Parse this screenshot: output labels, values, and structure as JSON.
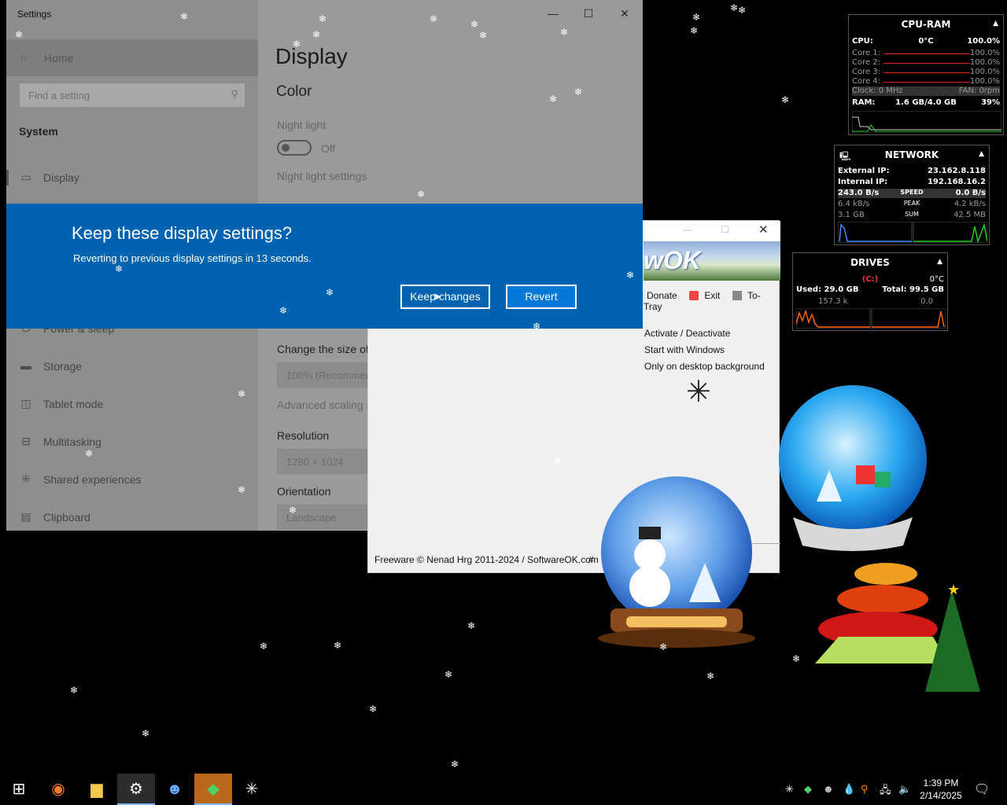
{
  "settings": {
    "window_title": "Settings",
    "controls": {
      "minimize": "—",
      "maximize": "☐",
      "close": "✕"
    },
    "sidebar": {
      "home": "Home",
      "search_placeholder": "Find a setting",
      "section": "System",
      "items": [
        {
          "label": "Display",
          "icon": "monitor-icon"
        },
        {
          "label": "Power & sleep",
          "icon": "power-icon"
        },
        {
          "label": "Storage",
          "icon": "storage-icon"
        },
        {
          "label": "Tablet mode",
          "icon": "tablet-icon"
        },
        {
          "label": "Multitasking",
          "icon": "multitasking-icon"
        },
        {
          "label": "Shared experiences",
          "icon": "shared-icon"
        },
        {
          "label": "Clipboard",
          "icon": "clipboard-icon"
        }
      ]
    },
    "content": {
      "title": "Display",
      "section_color": "Color",
      "night_light_label": "Night light",
      "night_light_state": "Off",
      "night_light_settings": "Night light settings",
      "scale_label": "Change the size of text, apps, and other items",
      "scale_value": "100% (Recommended)",
      "advanced_scaling": "Advanced scaling settings",
      "resolution_label": "Resolution",
      "resolution_value": "1280 × 1024",
      "orientation_label": "Orientation",
      "orientation_value": "Landscape"
    }
  },
  "dialog": {
    "title": "Keep these display settings?",
    "message": "Reverting to previous display settings in 13 seconds.",
    "keep_button": "Keep changes",
    "revert_button": "Revert"
  },
  "softwareok": {
    "banner_text": "wOK",
    "menu": {
      "donate": "Donate",
      "exit": "Exit",
      "to_tray": "To-Tray"
    },
    "options": [
      "Activate / Deactivate",
      "Start with Windows",
      "Only on desktop background"
    ],
    "footer": "Freeware © Nenad Hrg 2011-2024 / SoftwareOK.com",
    "footer_hash": "#"
  },
  "cpu_gadget": {
    "title": "CPU-RAM",
    "cpu_label": "CPU:",
    "cpu_temp": "0°C",
    "cpu_pct": "100.0%",
    "cores": [
      {
        "label": "Core 1:",
        "value": "100.0%"
      },
      {
        "label": "Core 2:",
        "value": "100.0%"
      },
      {
        "label": "Core 3:",
        "value": "100.0%"
      },
      {
        "label": "Core 4:",
        "value": "100.0%"
      }
    ],
    "clock": "Clock: 0 MHz",
    "fan": "FAN: 0rpm",
    "ram_label": "RAM:",
    "ram_value": "1.6 GB/4.0 GB",
    "ram_pct": "39%"
  },
  "network_gadget": {
    "title": "NETWORK",
    "external_label": "External IP:",
    "external_ip": "23.162.8.118",
    "internal_label": "Internal IP:",
    "internal_ip": "192.168.16.2",
    "speed_down": "243.0 B/s",
    "speed_label": "SPEED",
    "speed_up": "0.0 B/s",
    "peak_down": "6.4 kB/s",
    "peak_label": "PEAK",
    "peak_up": "4.2 kB/s",
    "sum_down": "3.1 GB",
    "sum_label": "SUM",
    "sum_up": "42.5 MB"
  },
  "drives_gadget": {
    "title": "DRIVES",
    "drive": "(C:)",
    "temp": "0°C",
    "used": "Used: 29.0 GB",
    "total": "Total: 99.5 GB",
    "read": "157.3 k",
    "write": "0.0"
  },
  "taskbar": {
    "icons": [
      "start-icon",
      "firefox-icon",
      "file-explorer-icon",
      "settings-icon",
      "people-icon",
      "softwareok-icon",
      "snowflake-icon"
    ],
    "time": "1:39 PM",
    "date": "2/14/2025"
  },
  "colors": {
    "dialog_blue": "#0063b1",
    "accent": "#0078d7"
  }
}
